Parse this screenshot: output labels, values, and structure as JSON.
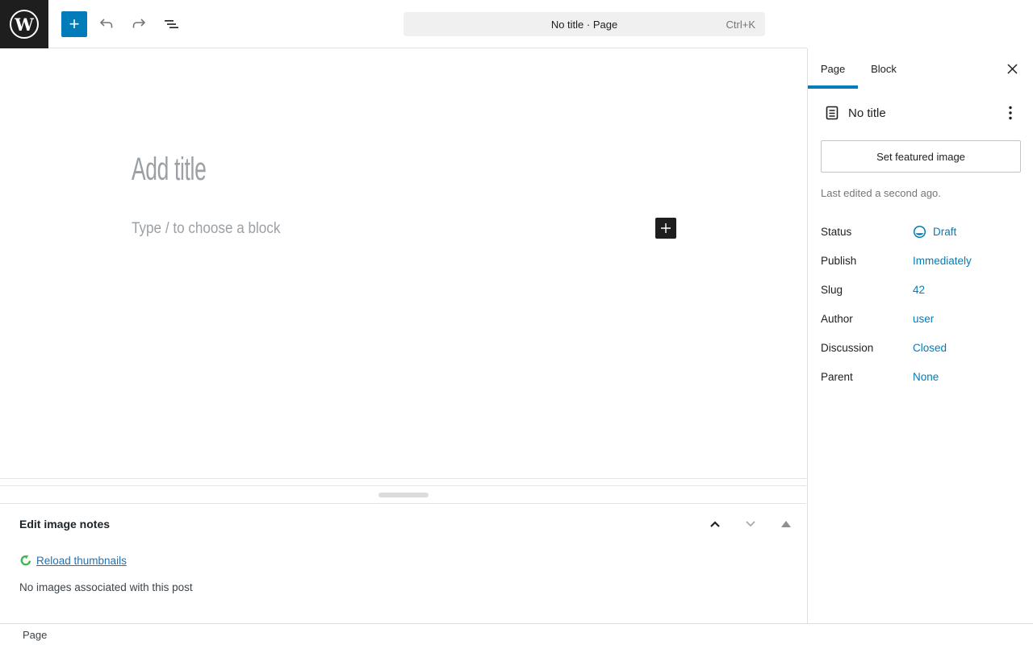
{
  "colors": {
    "accent": "#007cba",
    "admin_link": "#2271b1",
    "reload_green": "#46b450",
    "logo_background": "#1e1e1e"
  },
  "icons": {
    "wordpress_logo": "W",
    "inserter_plus": "+",
    "block_inserter_plus": "+",
    "kebab": "⋮",
    "toggle_triangle": "▲"
  },
  "header": {
    "command_bar": {
      "title": "No title · Page",
      "shortcut": "Ctrl+K"
    }
  },
  "editor": {
    "title_placeholder": "Add title",
    "block_placeholder": "Type / to choose a block"
  },
  "metabox": {
    "panel_title": "Edit image notes",
    "reload_link": "Reload thumbnails",
    "empty_text": "No images associated with this post"
  },
  "footer": {
    "breadcrumb": "Page"
  },
  "sidebar": {
    "tabs": [
      {
        "label": "Page"
      },
      {
        "label": "Block"
      }
    ],
    "summary": {
      "title": "No title"
    },
    "featured_button_label": "Set featured image",
    "last_edited": "Last edited a second ago.",
    "rows": [
      {
        "label": "Status",
        "value": "Draft"
      },
      {
        "label": "Publish",
        "value": "Immediately"
      },
      {
        "label": "Slug",
        "value": "42"
      },
      {
        "label": "Author",
        "value": "user"
      },
      {
        "label": "Discussion",
        "value": "Closed"
      },
      {
        "label": "Parent",
        "value": "None"
      }
    ]
  }
}
